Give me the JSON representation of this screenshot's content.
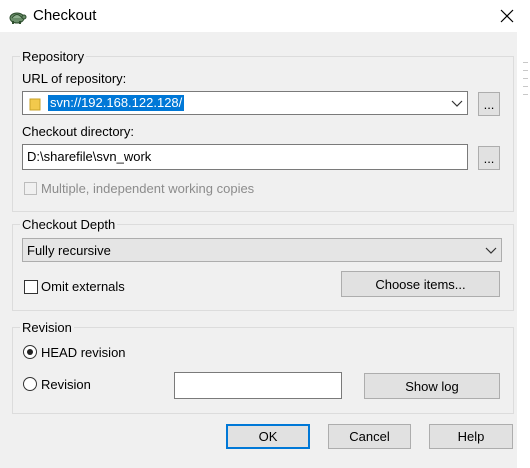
{
  "window": {
    "title": "Checkout",
    "close_icon": "close-icon"
  },
  "repository": {
    "group_label": "Repository",
    "url_label": "URL of repository:",
    "url_value": "svn://192.168.122.128/",
    "url_browse": "...",
    "dir_label": "Checkout directory:",
    "dir_value": "D:\\sharefile\\svn_work",
    "dir_browse": "...",
    "multiple_label": "Multiple, independent working copies"
  },
  "depth": {
    "group_label": "Checkout Depth",
    "selected": "Fully recursive",
    "omit_label": "Omit externals",
    "choose_items": "Choose items..."
  },
  "revision": {
    "group_label": "Revision",
    "head_label": "HEAD revision",
    "revision_label": "Revision",
    "revision_value": "",
    "show_log": "Show log"
  },
  "buttons": {
    "ok": "OK",
    "cancel": "Cancel",
    "help": "Help"
  },
  "colors": {
    "selection": "#0078d7",
    "dialog_bg": "#f0f0f0"
  }
}
